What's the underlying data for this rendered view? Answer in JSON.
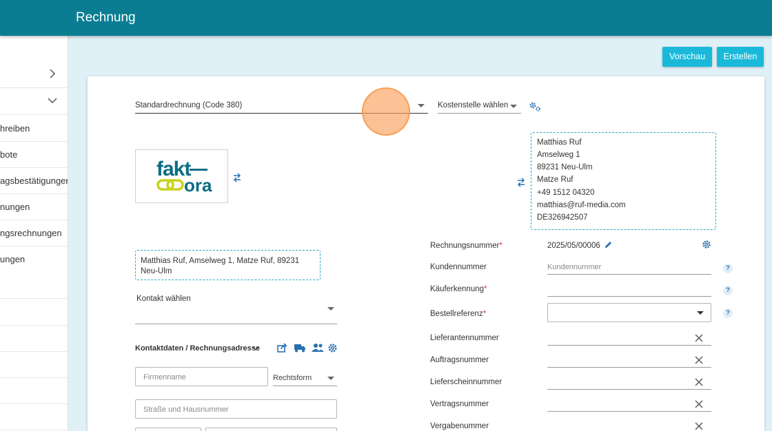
{
  "header": {
    "title": "Rechnung"
  },
  "sidebar": {
    "items": [
      {
        "label": ""
      },
      {
        "label": ""
      },
      {
        "label": "hreiben"
      },
      {
        "label": "bote"
      },
      {
        "label": "agsbestätigungen"
      },
      {
        "label": "nungen"
      },
      {
        "label": "ngsrechnungen"
      },
      {
        "label": "ungen"
      },
      {
        "label": ""
      },
      {
        "label": ""
      },
      {
        "label": ""
      },
      {
        "label": ""
      },
      {
        "label": ""
      }
    ]
  },
  "actions": {
    "preview": "Vorschau",
    "create": "Erstellen"
  },
  "form": {
    "invoice_type": "Standardrechnung (Code 380)",
    "cost_center": "Kostenstelle wählen",
    "logo_text_top": "fakt",
    "logo_text_bottom": "ora",
    "sender_lines": [
      "Matthias Ruf",
      "Amselweg 1",
      "89231 Neu-Ulm",
      "Matze Ruf",
      "+49 1512 04320",
      "matthias@ruf-media.com",
      "DE326942507"
    ],
    "sender_short": "Matthias Ruf, Amselweg 1, Matze Ruf, 89231 Neu-Ulm",
    "contact_label": "Kontakt wählen",
    "contact_section": "Kontaktdaten / Rechnungsadresse",
    "company_placeholder": "Firmenname",
    "legal_form": "Rechtsform",
    "street_placeholder": "Straße und Hausnummer",
    "right_fields": {
      "invoice_number_label": "Rechnungsnummer",
      "invoice_number_value": "2025/05/00006",
      "customer_number_label": "Kundennummer",
      "customer_number_placeholder": "Kundennummer",
      "buyer_ref_label": "Käuferkennung",
      "order_ref_label": "Bestellreferenz",
      "supplier_number_label": "Lieferantennummer",
      "job_number_label": "Auftragsnummer",
      "delivery_note_label": "Lieferscheinnummer",
      "contract_number_label": "Vertragsnummer",
      "tender_number_label": "Vergabenummer",
      "required_mark": "*",
      "help_mark": "?"
    }
  },
  "colors": {
    "header": "#0b7d93",
    "button": "#1bb9d9",
    "accent": "#2a6fb0"
  }
}
